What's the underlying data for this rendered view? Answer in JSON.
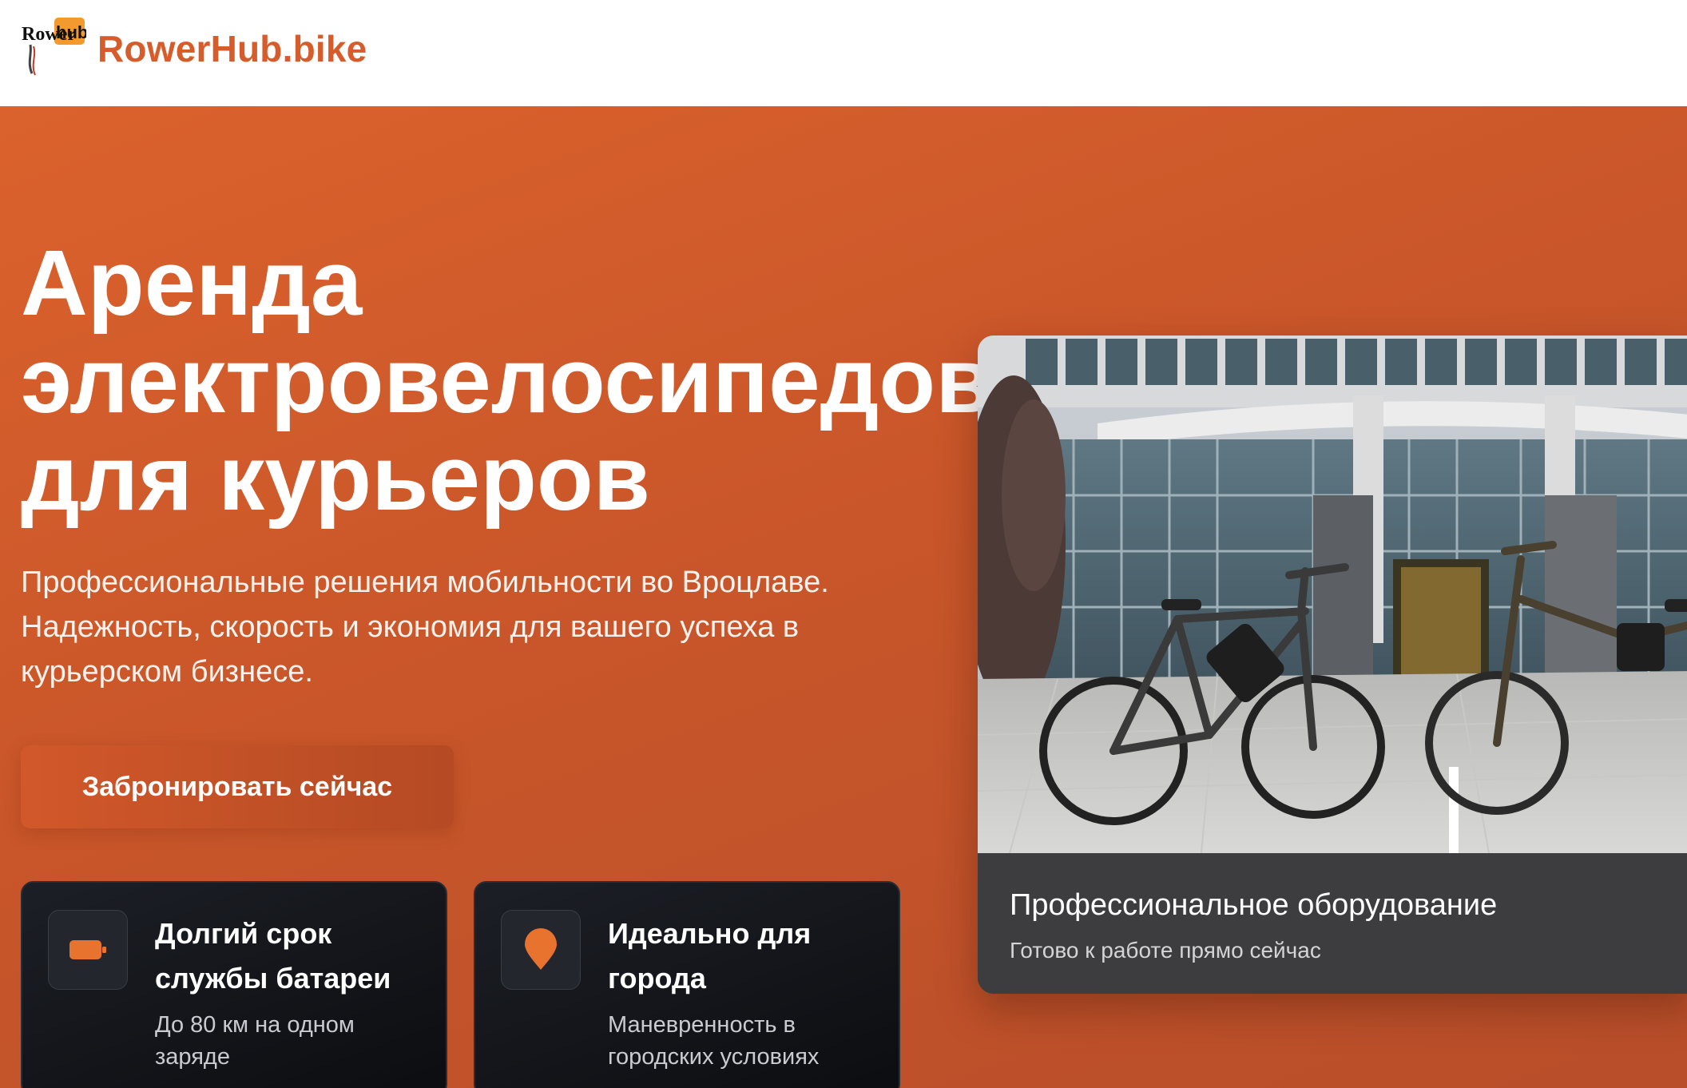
{
  "header": {
    "logo_text": "Rower hub",
    "brand_name": "RowerHub.bike"
  },
  "hero": {
    "title_lines": [
      "Аренда",
      "электровелосипедов",
      "для курьеров"
    ],
    "subtitle": "Профессиональные решения мобильности во Вроцлаве. Надежность, скорость и экономия для вашего успеха в курьерском бизнесе.",
    "cta_label": "Забронировать сейчас"
  },
  "features": [
    {
      "icon": "battery-icon",
      "title": "Долгий срок службы батареи",
      "description": "До 80 км на одном заряде"
    },
    {
      "icon": "location-pin-icon",
      "title": "Идеально для города",
      "description": "Маневренность в городских условиях"
    }
  ],
  "photo_card": {
    "caption_title": "Профессиональное оборудование",
    "caption_subtitle": "Готово к работе прямо сейчас"
  },
  "colors": {
    "brand": "#d65d2b",
    "hero_bg": "#cc5a2a",
    "accent_icon": "#e8732f",
    "card_dark": "#111318"
  }
}
